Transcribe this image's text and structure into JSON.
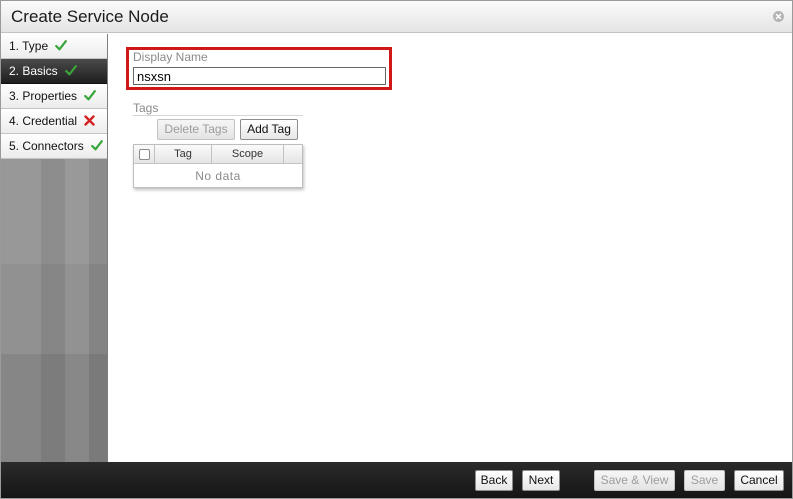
{
  "dialog": {
    "title": "Create Service Node"
  },
  "steps": [
    {
      "label": "1. Type",
      "status": "complete"
    },
    {
      "label": "2. Basics",
      "status": "complete",
      "active": true
    },
    {
      "label": "3. Properties",
      "status": "complete"
    },
    {
      "label": "4. Credential",
      "status": "error"
    },
    {
      "label": "5. Connectors",
      "status": "complete"
    }
  ],
  "form": {
    "display_name_label": "Display Name",
    "display_name_value": "nsxsn",
    "tags_label": "Tags",
    "delete_tags_label": "Delete Tags",
    "add_tag_label": "Add Tag",
    "tags_grid": {
      "columns": [
        "Tag",
        "Scope"
      ],
      "empty_text": "No data"
    }
  },
  "footer": {
    "back_label": "Back",
    "next_label": "Next",
    "save_view_label": "Save & View",
    "save_label": "Save",
    "cancel_label": "Cancel"
  },
  "colors": {
    "highlight": "#d01818",
    "check": "#3aa53a",
    "error": "#d42222"
  },
  "icons": {
    "complete": "checkmark-icon",
    "error": "x-icon",
    "close": "close-icon"
  }
}
